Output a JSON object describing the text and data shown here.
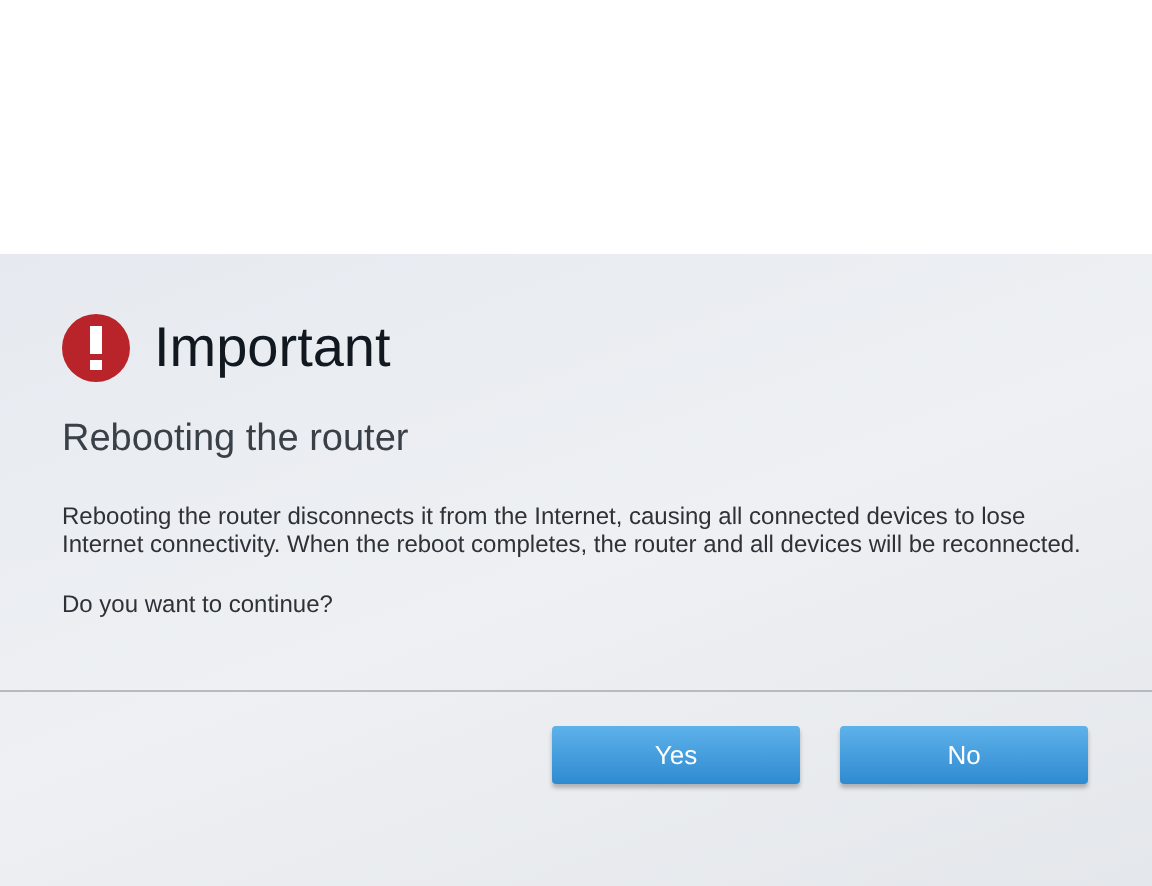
{
  "dialog": {
    "title": "Important",
    "subtitle": "Rebooting the router",
    "message": "Rebooting the router disconnects it from the Internet, causing all connected devices to lose Internet connectivity. When the reboot completes, the router and all devices will be reconnected.",
    "question": "Do you want to continue?",
    "buttons": [
      "Yes",
      "No"
    ]
  }
}
